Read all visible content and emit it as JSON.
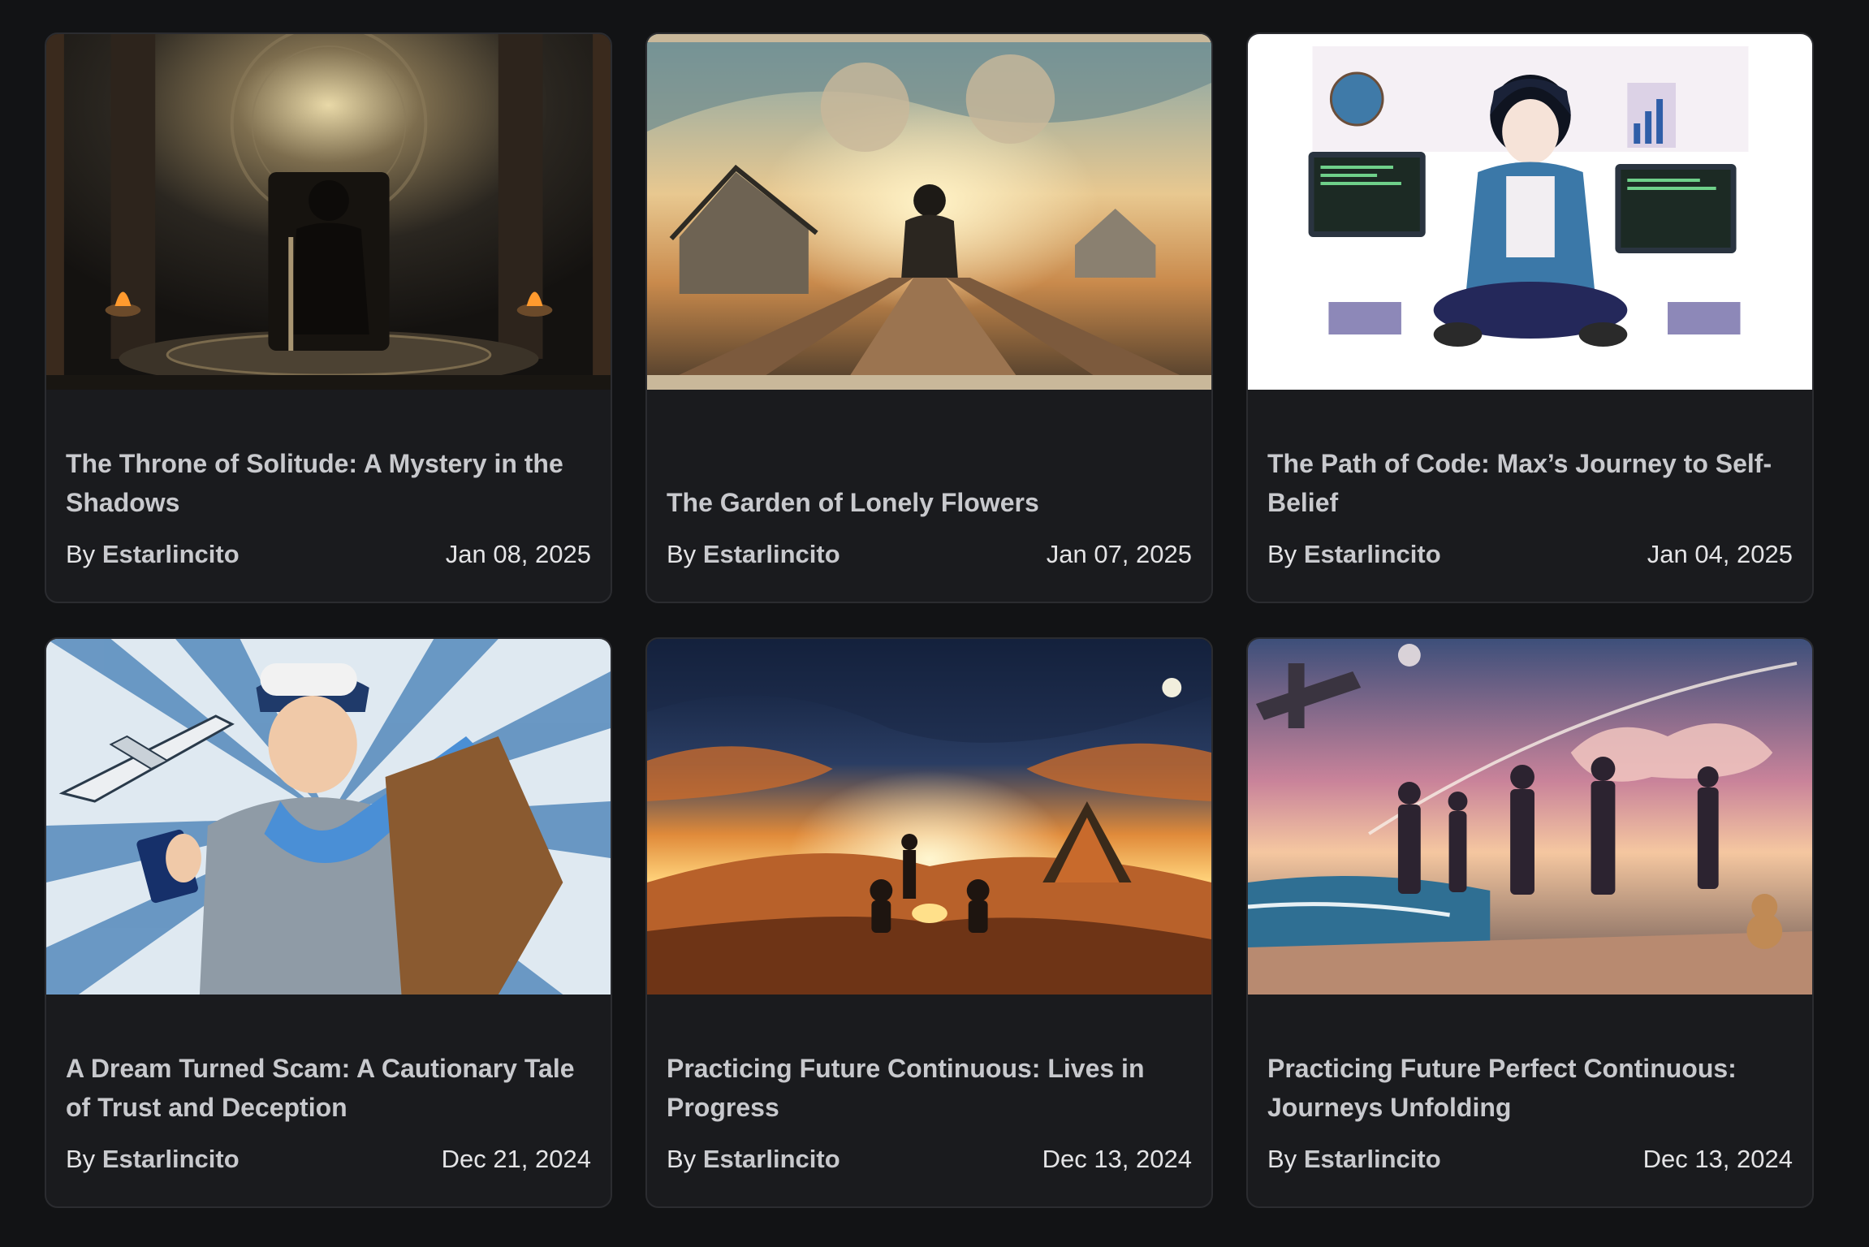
{
  "posts": [
    {
      "title": "The Throne of Solitude: A Mystery in the Shadows",
      "by_prefix": "By",
      "author": "Estarlincito",
      "date": "Jan 08, 2025",
      "image_icon": "dark-throne-illustration"
    },
    {
      "title": "The Garden of Lonely Flowers",
      "by_prefix": "By",
      "author": "Estarlincito",
      "date": "Jan 07, 2025",
      "image_icon": "village-boardwalk-illustration"
    },
    {
      "title": "The Path of Code: Max’s Journey to Self-Belief",
      "by_prefix": "By",
      "author": "Estarlincito",
      "date": "Jan 04, 2025",
      "image_icon": "coder-desk-illustration"
    },
    {
      "title": "A Dream Turned Scam: A Cautionary Tale of Trust and Deception",
      "by_prefix": "By",
      "author": "Estarlincito",
      "date": "Dec 21, 2024",
      "image_icon": "traveler-airplane-illustration"
    },
    {
      "title": "Practicing Future Continuous: Lives in Progress",
      "by_prefix": "By",
      "author": "Estarlincito",
      "date": "Dec 13, 2024",
      "image_icon": "desert-campfire-illustration"
    },
    {
      "title": "Practicing Future Perfect Continuous: Journeys Unfolding",
      "by_prefix": "By",
      "author": "Estarlincito",
      "date": "Dec 13, 2024",
      "image_icon": "travelers-beach-illustration"
    }
  ],
  "colors": {
    "background": "#121315",
    "card": "#1a1b1e",
    "card_border": "#2b2c30",
    "title_text": "#c8c9cd",
    "meta_text": "#e4e4e6"
  }
}
